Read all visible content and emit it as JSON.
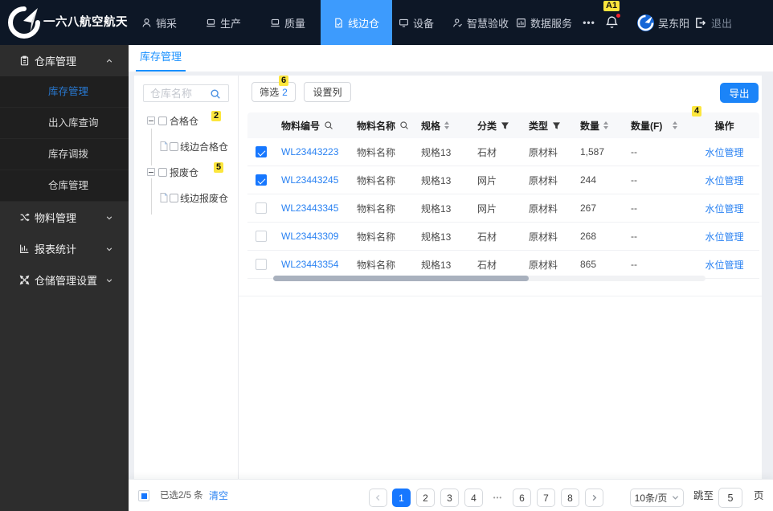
{
  "colors": {
    "accent": "#1890ff",
    "primary_button": "#1b84f8",
    "active_nav": "#3d9bfd",
    "annotation_badge": "#fce63d",
    "header_bg": "#0d1726",
    "sidebar_bg": "#2d2d2d"
  },
  "header": {
    "brand": "一六八航空航天",
    "nav": [
      {
        "label": "销采"
      },
      {
        "label": "生产"
      },
      {
        "label": "质量"
      },
      {
        "label": "线边仓"
      },
      {
        "label": "设备"
      },
      {
        "label": "智慧验收"
      },
      {
        "label": "数据服务"
      }
    ],
    "more": "•••",
    "notification_badge": "A1",
    "user": "吴东阳",
    "logout": "退出"
  },
  "sidebar": {
    "groups": [
      {
        "label": "仓库管理",
        "expanded": true,
        "children": [
          {
            "label": "库存管理",
            "active": true
          },
          {
            "label": "出入库查询"
          },
          {
            "label": "库存调拨"
          },
          {
            "label": "仓库管理"
          }
        ]
      },
      {
        "label": "物料管理",
        "expanded": false
      },
      {
        "label": "报表统计",
        "expanded": false
      },
      {
        "label": "仓储管理设置",
        "expanded": false
      }
    ]
  },
  "tabs": {
    "active": "库存管理"
  },
  "tree": {
    "search_placeholder": "仓库名称",
    "nodes": [
      {
        "label": "合格仓",
        "badge": "2",
        "children": [
          {
            "label": "线边合格仓"
          }
        ]
      },
      {
        "label": "报废仓",
        "badge": "5",
        "children": [
          {
            "label": "线边报废仓"
          }
        ]
      }
    ]
  },
  "toolbar": {
    "filter_label": "筛选",
    "filter_count": "2",
    "filter_badge": "6",
    "columns_label": "设置列",
    "export_label": "导出"
  },
  "table": {
    "headers": {
      "code": "物料编号",
      "name": "物料名称",
      "spec": "规格",
      "category": "分类",
      "type": "类型",
      "qty": "数量",
      "qty_f": "数量(F)",
      "action": "操作"
    },
    "qty_f_badge": "4",
    "action_label": "水位管理",
    "rows": [
      {
        "selected": true,
        "code": "WL23443223",
        "name": "物料名称",
        "spec": "规格13",
        "category": "石材",
        "type": "原材料",
        "qty": "1,587",
        "qty_f": "--",
        "action": "水位管理"
      },
      {
        "selected": true,
        "code": "WL23443245",
        "name": "物料名称",
        "spec": "规格13",
        "category": "网片",
        "type": "原材料",
        "qty": "244",
        "qty_f": "--",
        "action": "水位管理"
      },
      {
        "selected": false,
        "code": "WL23443345",
        "name": "物料名称",
        "spec": "规格13",
        "category": "网片",
        "type": "原材料",
        "qty": "267",
        "qty_f": "--",
        "action": "水位管理"
      },
      {
        "selected": false,
        "code": "WL23443309",
        "name": "物料名称",
        "spec": "规格13",
        "category": "石材",
        "type": "原材料",
        "qty": "268",
        "qty_f": "--",
        "action": "水位管理"
      },
      {
        "selected": false,
        "code": "WL23443354",
        "name": "物料名称",
        "spec": "规格13",
        "category": "石材",
        "type": "原材料",
        "qty": "865",
        "qty_f": "--",
        "action": "水位管理"
      }
    ]
  },
  "footer": {
    "selected_text": "已选2/5 条",
    "clear_label": "清空",
    "pages": [
      "1",
      "2",
      "3",
      "4",
      "•••",
      "6",
      "7",
      "8"
    ],
    "active_page": "1",
    "page_size": "10条/页",
    "jump_label": "跳至",
    "jump_value": "5",
    "page_suffix": "页"
  }
}
